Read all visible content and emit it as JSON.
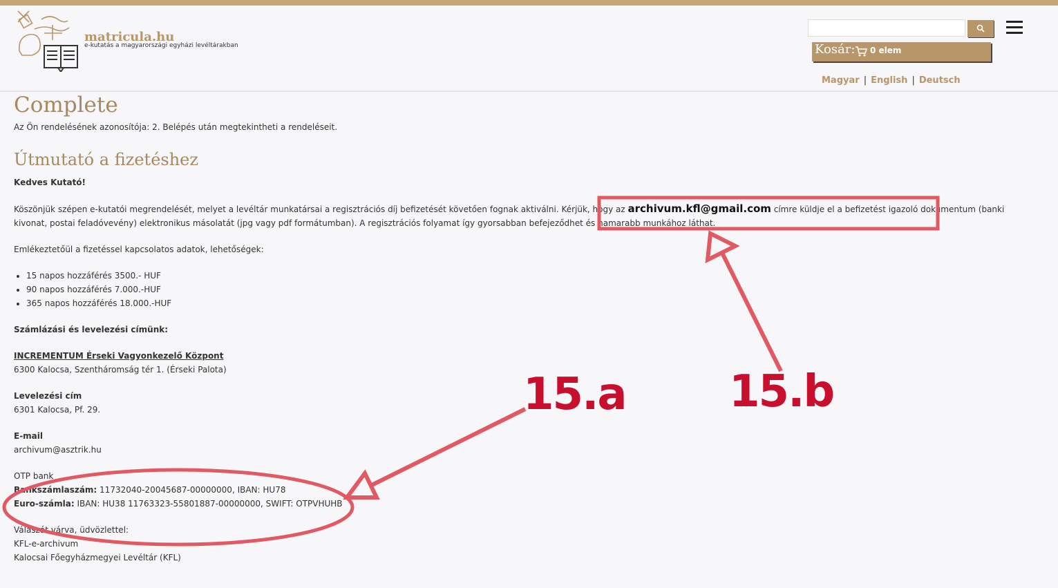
{
  "header": {
    "site_name": "matricula.hu",
    "site_tagline": "e-kutatás a magyarországi egyházi levéltárakban",
    "cart_label": "Kosár:",
    "cart_count": "0 elem",
    "languages": [
      "Magyar",
      "English",
      "Deutsch"
    ]
  },
  "search": {
    "placeholder": "",
    "value": ""
  },
  "main": {
    "title": "Complete",
    "order_text": "Az Ön rendelésének azonosítója: 2. Belépés után megtekintheti a rendeléseit.",
    "section_title": "Útmutató a fizetéshez",
    "greeting": "Kedves Kutató!",
    "intro_before": "Köszönjük szépen e-kutatói megrendelését, melyet a levéltár munkatársai a regisztrációs díj befizetését követően fognak aktiválni. Kérjük, hogy az ",
    "intro_email": "archivum.kfl@gmail.com",
    "intro_after": " címre küldje el a befizetést igazoló dokumentum (banki kivonat, postai feladóvevény) elektronikus másolatát (jpg vagy pdf formátumban). A regisztrációs folyamat így gyorsabban befejeződhet és hamarabb munkához láthat.",
    "reminder": "Emlékeztetőül a fizetéssel kapcsolatos adatok, lehetőségek:",
    "prices": [
      "15 napos hozzáférés 3500.- HUF",
      "90 napos hozzáférés 7.000.-HUF",
      "365 napos hozzáférés 18.000.-HUF"
    ],
    "billing_heading": "Számlázási és levelezési címünk:",
    "org_name": "INCREMENTUM Érseki Vagyonkezelő Központ",
    "org_address": "6300 Kalocsa, Szentháromság tér 1. (Érseki Palota)",
    "postal_heading": "Levelezési cím",
    "postal_address": "6301 Kalocsa, Pf. 29.",
    "email_heading": "E-mail",
    "email_value": "archivum@asztrik.hu",
    "bank_name": "OTP bank",
    "account_label": "Bankszámlaszám:",
    "account_value": " 11732040-20045687-00000000, IBAN: HU78",
    "euro_label": "Euro-számla:",
    "euro_value": " IBAN: HU38 11763323-55801887-00000000, SWIFT: OTPVHUHB",
    "closing": "Válaszát várva, üdvözlettel:",
    "signature_1": "KFL-e-archivum",
    "signature_2": "Kalocsai Főegyházmegyei Levéltár (KFL)"
  },
  "annotations": {
    "label_a": "15.a",
    "label_b": "15.b",
    "color": "#e05a64",
    "text_color": "#c8102e"
  },
  "colors": {
    "accent": "#b8966a",
    "heading": "#a8885e",
    "topbar": "#c6a676",
    "background": "#f7f6f8"
  }
}
